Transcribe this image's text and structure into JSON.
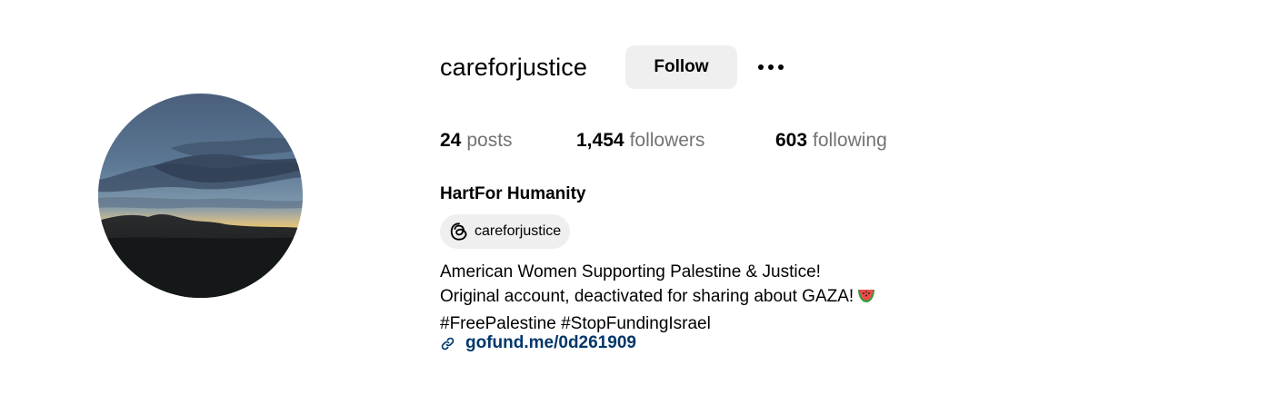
{
  "profile": {
    "username": "careforjustice",
    "follow_label": "Follow",
    "more_options_icon": "more-horizontal-icon",
    "avatar_description": "sunset-sky-photo"
  },
  "stats": {
    "posts_count": "24",
    "posts_label": "posts",
    "followers_count": "1,454",
    "followers_label": "followers",
    "following_count": "603",
    "following_label": "following"
  },
  "bio": {
    "full_name": "HartFor Humanity",
    "threads_handle": "careforjustice",
    "lines": [
      "American Women Supporting Palestine & Justice!",
      "Original account, deactivated for sharing about GAZA!",
      "#FreePalestine #StopFundingIsrael"
    ],
    "link_text": "gofund.me/0d261909"
  },
  "colors": {
    "button_bg": "#efefef",
    "muted_text": "#737373",
    "link": "#00376b"
  }
}
